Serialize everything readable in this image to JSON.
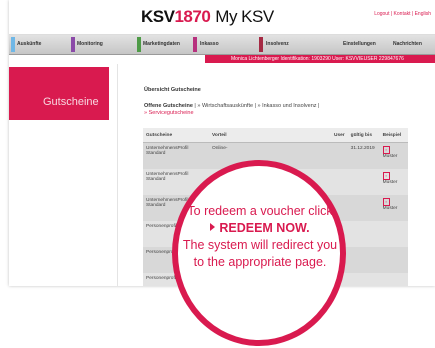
{
  "header": {
    "brand_ksv": "KSV",
    "brand_year": "1870",
    "brand_product": "My KSV",
    "top_links": "Logout | Kontakt | English"
  },
  "nav": {
    "items": [
      {
        "label": "Auskünfte",
        "color": "#6fb7e6"
      },
      {
        "label": "Monitoring",
        "color": "#8b4aa8"
      },
      {
        "label": "Marketingdaten",
        "color": "#4e9b47"
      },
      {
        "label": "Inkasso",
        "color": "#b7317e"
      },
      {
        "label": "Insolvenz",
        "color": "#a52a44"
      },
      {
        "label": "Einstellungen",
        "color": "#999999"
      },
      {
        "label": "Nachrichten",
        "color": "#999999"
      }
    ]
  },
  "info_bar": "Monica Lichtenberger  Identifikation: 1903290  User: KSVVIEUSER 229847676",
  "sidebar": {
    "title": "Gutscheine"
  },
  "page": {
    "title": "Übersicht Gutscheine",
    "tabs_active": "Offene Gutscheine",
    "tabs_rest": " | » Wirtschaftsauskünfte | » Inkasso und Insolvenz |",
    "tabs_line2": "» Servicegutscheine"
  },
  "table": {
    "headers": [
      "Gutscheine",
      "Vorteil",
      "",
      "User",
      "gültig bis",
      "Beispiel"
    ],
    "rows": [
      [
        "UnternehmensProfil Standard",
        "Online-",
        "",
        "",
        "31.12.2019",
        "Muster"
      ],
      [
        "UnternehmensProfil Standard",
        "",
        "",
        "",
        "",
        "Muster"
      ],
      [
        "UnternehmensProfil Standard",
        "",
        "",
        "",
        "",
        "Muster"
      ],
      [
        "Personenprofil Consumer",
        "",
        "",
        "",
        "",
        ""
      ],
      [
        "Personenprofil Consumer",
        "",
        "",
        "",
        "",
        ""
      ],
      [
        "Personenprofil",
        "",
        "",
        "",
        "",
        ""
      ]
    ]
  },
  "callout": {
    "line1": "To redeem a voucher click",
    "action": "REDEEM NOW.",
    "line2": "The system will redirect you",
    "line3": "to the appropriate page."
  },
  "colors": {
    "accent": "#d91a4f"
  }
}
